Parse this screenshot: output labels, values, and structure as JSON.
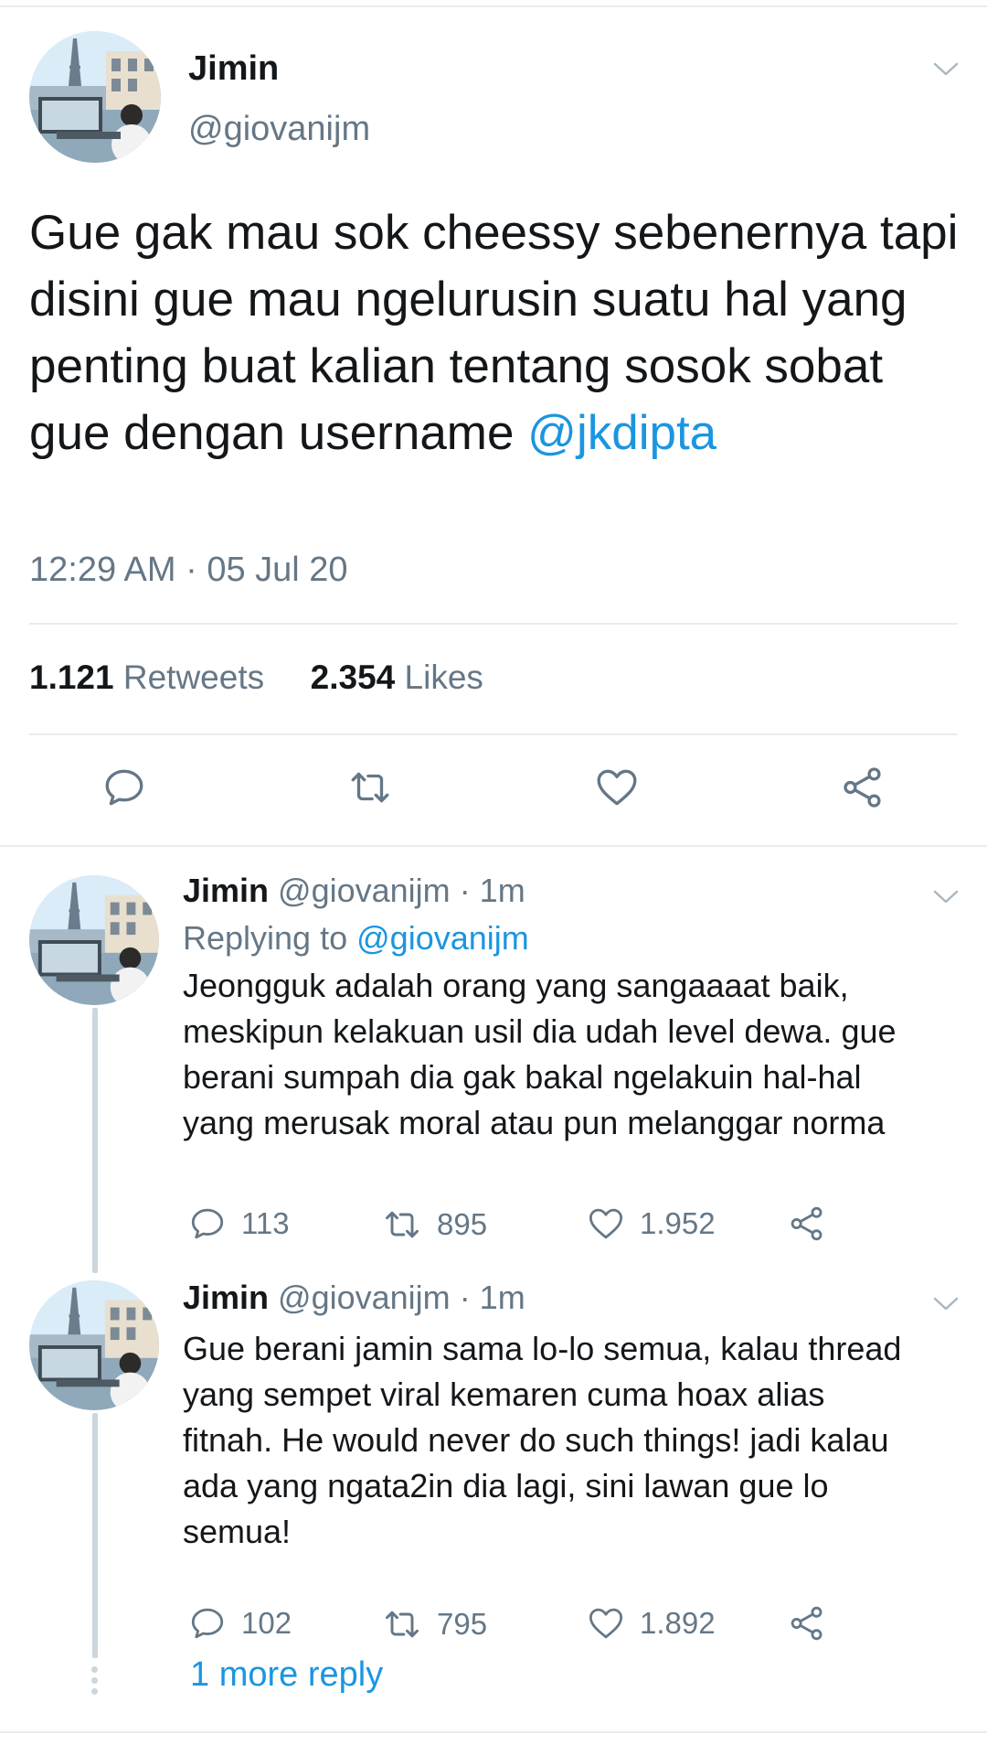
{
  "main_tweet": {
    "author_name": "Jimin",
    "author_handle": "@giovanijm",
    "text": "Gue gak mau sok cheessy sebenernya tapi disini gue mau ngelurusin suatu hal yang penting buat kalian tentang sosok sobat gue dengan username ",
    "mention": "@jkdipta",
    "timestamp": "12:29 AM · 05 Jul 20",
    "retweets_count": "1.121",
    "retweets_label": "Retweets",
    "likes_count": "2.354",
    "likes_label": "Likes"
  },
  "replies": [
    {
      "author_name": "Jimin",
      "author_handle": "@giovanijm",
      "time": "· 1m",
      "replying_label": "Replying to",
      "replying_to": "@giovanijm",
      "text_lines": [
        "Jeongguk adalah orang yang sangaaaat baik,",
        "meskipun kelakuan usil dia udah level dewa. gue",
        "berani sumpah dia gak bakal ngelakuin hal-hal",
        "yang merusak moral atau pun melanggar norma"
      ],
      "reply_count": "113",
      "retweet_count": "895",
      "like_count": "1.952"
    },
    {
      "author_name": "Jimin",
      "author_handle": "@giovanijm",
      "time": "· 1m",
      "text_lines": [
        "Gue berani jamin sama lo-lo semua, kalau thread",
        "yang sempet viral kemaren cuma hoax alias",
        "fitnah. He would never do such things! jadi kalau",
        "ada yang ngata2in dia lagi, sini lawan gue lo",
        "semua!"
      ],
      "reply_count": "102",
      "retweet_count": "795",
      "like_count": "1.892"
    }
  ],
  "more_replies": "1 more reply",
  "colors": {
    "text": "#14171a",
    "secondary": "#657786",
    "link": "#1b95e0",
    "divider": "#e6ecf0",
    "thread_line": "#ccd6dd"
  },
  "icons": [
    "reply-icon",
    "retweet-icon",
    "like-icon",
    "share-icon",
    "chevron-down-icon"
  ]
}
